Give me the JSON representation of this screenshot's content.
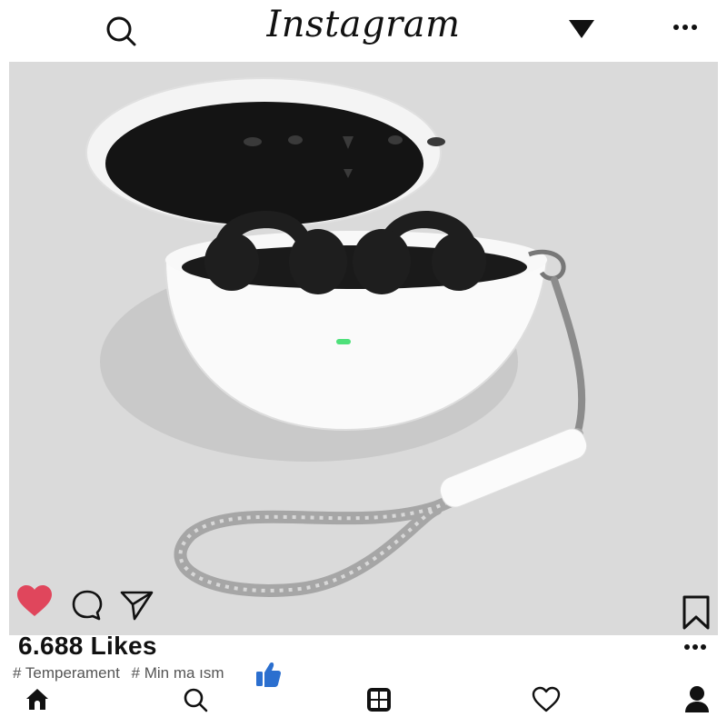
{
  "header": {
    "logo_text": "Instagram",
    "search_icon": "search-icon",
    "dropdown_icon": "triangle-down-icon",
    "more_icon": "more-horizontal-icon"
  },
  "post": {
    "image_alt": "White earbuds charging case with braided lanyard",
    "actions": {
      "like_icon": "heart-filled-icon",
      "comment_icon": "comment-icon",
      "share_icon": "send-icon",
      "save_icon": "bookmark-icon",
      "like_color": "#e0465c"
    },
    "likes_text": "6.688 Likes",
    "more_icon": "more-horizontal-icon",
    "hashtags": [
      "# Temperament",
      "# Min ma ısm"
    ],
    "thumbs_icon": "thumbs-up-icon",
    "thumbs_color": "#2b6fcf"
  },
  "bottom_nav": {
    "items": [
      "home-icon",
      "search-icon",
      "reels-icon",
      "heart-outline-icon",
      "profile-icon"
    ]
  }
}
